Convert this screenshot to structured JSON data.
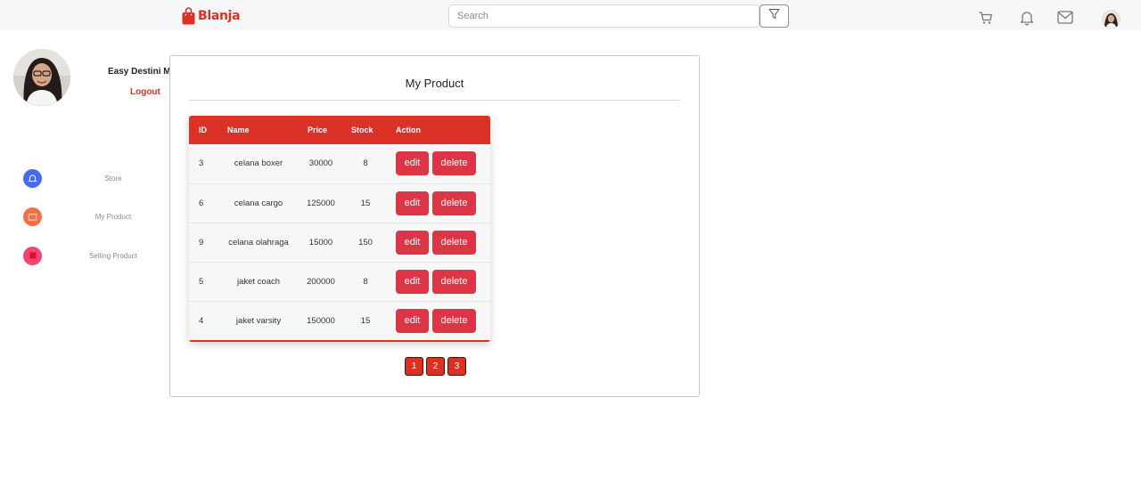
{
  "app": {
    "brand": "Blanja",
    "accent": "#db3022"
  },
  "header": {
    "search_placeholder": "Search",
    "icons": [
      "filter-icon",
      "cart-icon",
      "bell-icon",
      "mail-icon",
      "avatar"
    ]
  },
  "sidebar": {
    "profile_name": "Easy Destini Ma",
    "logout_label": "Logout",
    "items": [
      {
        "label": "Store",
        "icon": "bell-icon",
        "color": "#456bf0"
      },
      {
        "label": "My Product",
        "icon": "box-icon",
        "color": "#f36f45"
      },
      {
        "label": "Selling Product",
        "icon": "cart-icon",
        "color": "#f3456f"
      }
    ]
  },
  "main": {
    "title": "My Product",
    "table": {
      "headers": [
        "ID",
        "Name",
        "Price",
        "Stock",
        "Action"
      ],
      "rows": [
        {
          "id": "3",
          "name": "celana boxer",
          "price": "30000",
          "stock": "8"
        },
        {
          "id": "6",
          "name": "celana cargo",
          "price": "125000",
          "stock": "15"
        },
        {
          "id": "9",
          "name": "celana olahraga",
          "price": "15000",
          "stock": "150"
        },
        {
          "id": "5",
          "name": "jaket coach",
          "price": "200000",
          "stock": "8"
        },
        {
          "id": "4",
          "name": "jaket varsity",
          "price": "150000",
          "stock": "15"
        }
      ],
      "edit_label": "edit",
      "delete_label": "delete"
    },
    "pagination": [
      "1",
      "2",
      "3"
    ]
  }
}
